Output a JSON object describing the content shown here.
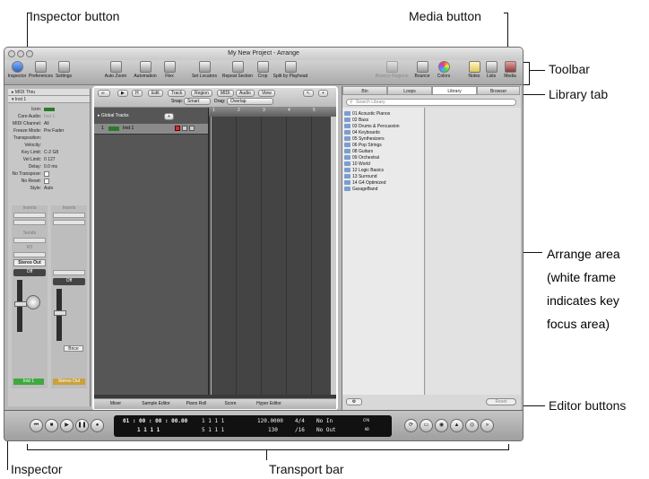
{
  "callouts": {
    "inspector_button": "Inspector button",
    "media_button": "Media button",
    "toolbar": "Toolbar",
    "library_tab": "Library tab",
    "arrange_area": [
      "Arrange area",
      "(white frame",
      "indicates key",
      "focus area)"
    ],
    "editor_buttons": "Editor buttons",
    "inspector": "Inspector",
    "transport_bar": "Transport bar"
  },
  "window": {
    "title": "My New Project - Arrange"
  },
  "toolbar": {
    "left": [
      "Inspector",
      "Preferences",
      "Settings",
      "Auto Zoom",
      "Automation",
      "Flex",
      "Set Locators",
      "Repeat Section",
      "Crop",
      "Split by Playhead"
    ],
    "right": [
      "Bounce Regions",
      "Bounce",
      "Colors",
      "Notes",
      "Lists",
      "Media"
    ]
  },
  "inspector": {
    "midi_thru": "MIDI Thru",
    "inst": "Inst 1",
    "rows": [
      {
        "k": "Icon:",
        "v": ""
      },
      {
        "k": "Core Audio:",
        "v": "Inst 1"
      },
      {
        "k": "MIDI Channel:",
        "v": "All"
      },
      {
        "k": "Freeze Mode:",
        "v": "Pre Fader"
      },
      {
        "k": "Transposition:",
        "v": ""
      },
      {
        "k": "Velocity:",
        "v": ""
      },
      {
        "k": "Key Limit:",
        "v": "C-2  G8"
      },
      {
        "k": "Vel Limit:",
        "v": "0    127"
      },
      {
        "k": "Delay:",
        "v": "0.0 ms"
      },
      {
        "k": "No Transpose:",
        "v": ""
      },
      {
        "k": "No Reset:",
        "v": ""
      },
      {
        "k": "Style:",
        "v": "Auto"
      }
    ],
    "inserts": "Inserts",
    "sends": "Sends",
    "io": "I/O",
    "stereo_out": "Stereo Out",
    "off": "Off",
    "strip1": "Inst 1",
    "strip2": "Stereo Out",
    "bnce": "Bnce"
  },
  "arrange": {
    "menus": [
      "Edit",
      "Track",
      "Region",
      "MIDI",
      "Audio",
      "View"
    ],
    "snap_label": "Snap:",
    "snap_value": "Smart",
    "drag_label": "Drag:",
    "drag_value": "Overlap",
    "global_tracks": "Global Tracks",
    "track_number": "1",
    "track_name": "Inst 1",
    "ruler": [
      "1",
      "2",
      "3",
      "4",
      "5"
    ]
  },
  "editors": [
    "Mixer",
    "Sample Editor",
    "Piano Roll",
    "Score",
    "Hyper Editor"
  ],
  "media": {
    "tabs": [
      "Bin",
      "Loops",
      "Library",
      "Browser"
    ],
    "search_placeholder": "Search Library",
    "items": [
      "01 Acoustic Pianos",
      "02 Bass",
      "03 Drums & Percussion",
      "04 Keyboards",
      "05 Synthesizers",
      "06 Pop Strings",
      "08 Guitars",
      "09 Orchestral",
      "10 World",
      "12 Logic Basics",
      "13 Surround",
      "14 G4 Optimized",
      "GarageBand"
    ],
    "reset": "Reset"
  },
  "transport": {
    "time_top": "01 : 00 : 00 : 00.00",
    "time_bottom": "1    1    1    1",
    "pos_top": "1    1    1    1",
    "pos_bottom": "5    1    1    1",
    "tempo_top": "120.0000",
    "tempo_bottom": "130",
    "sig_top": "4/4",
    "sig_bottom": "/16",
    "in": "No In",
    "out": "No Out",
    "cpu": "CPU",
    "hd": "HD"
  }
}
